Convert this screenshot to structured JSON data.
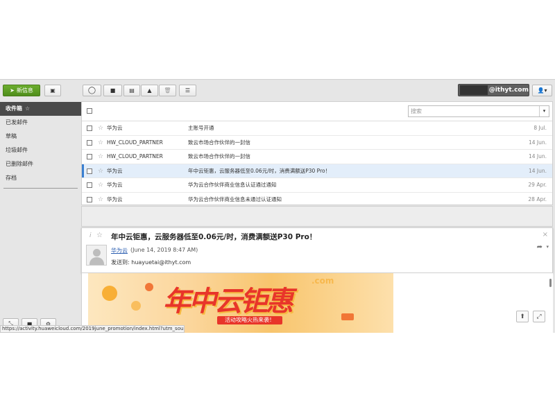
{
  "toolbar": {
    "new_label": "新信息",
    "account_domain": "@ithyt.com"
  },
  "sidebar": {
    "folders": [
      {
        "label": "收件箱"
      },
      {
        "label": "已发邮件"
      },
      {
        "label": "草稿"
      },
      {
        "label": "垃圾邮件"
      },
      {
        "label": "已删除邮件"
      },
      {
        "label": "存档"
      }
    ]
  },
  "search": {
    "placeholder": "搜索"
  },
  "messages": [
    {
      "from": "华为云",
      "subject": "主账号开通",
      "date": "8 Jul."
    },
    {
      "from": "HW_CLOUD_PARTNER",
      "subject": "致云市场合作伙伴的一封信",
      "date": "14 Jun."
    },
    {
      "from": "HW_CLOUD_PARTNER",
      "subject": "致云市场合作伙伴的一封信",
      "date": "14 Jun."
    },
    {
      "from": "华为云",
      "subject": "年中云钜惠，云服务器低至0.06元/时，消费满额送P30 Pro！",
      "date": "14 Jun."
    },
    {
      "from": "华为云",
      "subject": "华为云合作伙伴商业信息认证通过通知",
      "date": "29 Apr."
    },
    {
      "from": "华为云",
      "subject": "华为云合作伙伴商业信息未通过认证通知",
      "date": "28 Apr."
    }
  ],
  "preview": {
    "subject": "年中云钜惠，云服务器低至0.06元/时，消费满额送P30 Pro！",
    "sender": "华为云",
    "date": "(June 14, 2019 8:47 AM)",
    "to_label": "发送到:",
    "to_address": "huayuetai@ithyt.com",
    "banner_title": "年中云钜惠",
    "banner_ribbon": "活动攻略火热来袭！",
    "banner_domain": ".com"
  },
  "status_url": "https://activity.huaweicloud.com/2019june_promotion/index.html?utm_sour..."
}
